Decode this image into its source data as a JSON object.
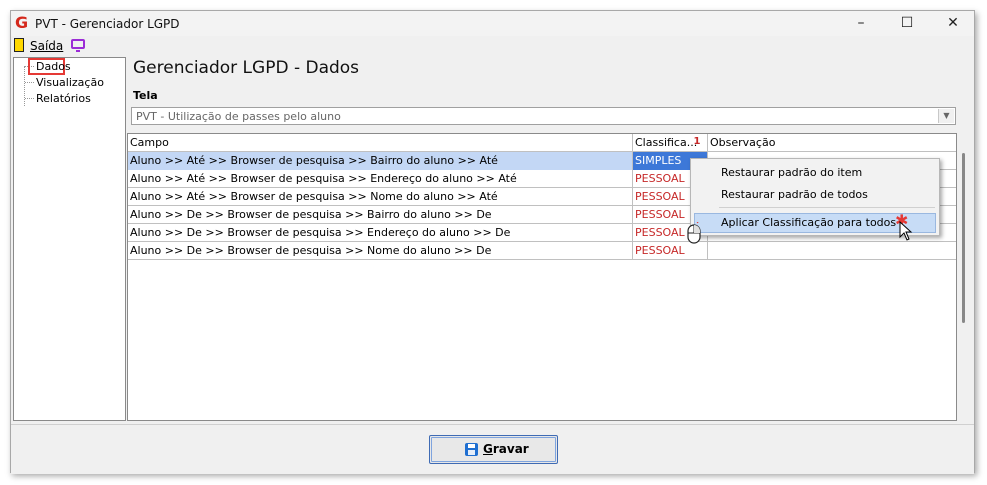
{
  "window": {
    "title": "PVT - Gerenciador LGPD",
    "controls": {
      "minimize": "–",
      "maximize": "☐",
      "close": "✕"
    }
  },
  "menubar": {
    "exit_label": "Saída"
  },
  "tree": {
    "items": [
      {
        "label": "Dados",
        "selected": true
      },
      {
        "label": "Visualização",
        "selected": false
      },
      {
        "label": "Relatórios",
        "selected": false
      }
    ]
  },
  "main": {
    "title": "Gerenciador LGPD - Dados",
    "tela_label": "Tela",
    "tela_value": "PVT - Utilização de passes pelo aluno"
  },
  "grid": {
    "columns": [
      "Campo",
      "Classifica...",
      "Observação"
    ],
    "sort_indicator": "1",
    "rows": [
      {
        "campo": "Aluno >> Até >> Browser de pesquisa >> Bairro do aluno >> Até",
        "classificacao": "SIMPLES",
        "observacao": ""
      },
      {
        "campo": "Aluno >> Até >> Browser de pesquisa >> Endereço do aluno >> Até",
        "classificacao": "PESSOAL",
        "observacao": ""
      },
      {
        "campo": "Aluno >> Até >> Browser de pesquisa >> Nome do aluno >> Até",
        "classificacao": "PESSOAL",
        "observacao": ""
      },
      {
        "campo": "Aluno >> De >> Browser de pesquisa >> Bairro do aluno >> De",
        "classificacao": "PESSOAL",
        "observacao": ""
      },
      {
        "campo": "Aluno >> De >> Browser de pesquisa >> Endereço do aluno >> De",
        "classificacao": "PESSOAL",
        "observacao": ""
      },
      {
        "campo": "Aluno >> De >> Browser de pesquisa >> Nome do aluno >> De",
        "classificacao": "PESSOAL",
        "observacao": ""
      }
    ]
  },
  "context_menu": {
    "items": [
      "Restaurar padrão do item",
      "Restaurar padrão de todos",
      "Aplicar Classificação para todos"
    ],
    "highlight_marker": "✱"
  },
  "footer": {
    "save_first": "G",
    "save_rest": "ravar"
  },
  "colors": {
    "accent_red": "#e53935",
    "selection_blue": "#3d78d8",
    "menu_highlight": "#c7dcf6",
    "button_border": "#3f6bb4"
  }
}
